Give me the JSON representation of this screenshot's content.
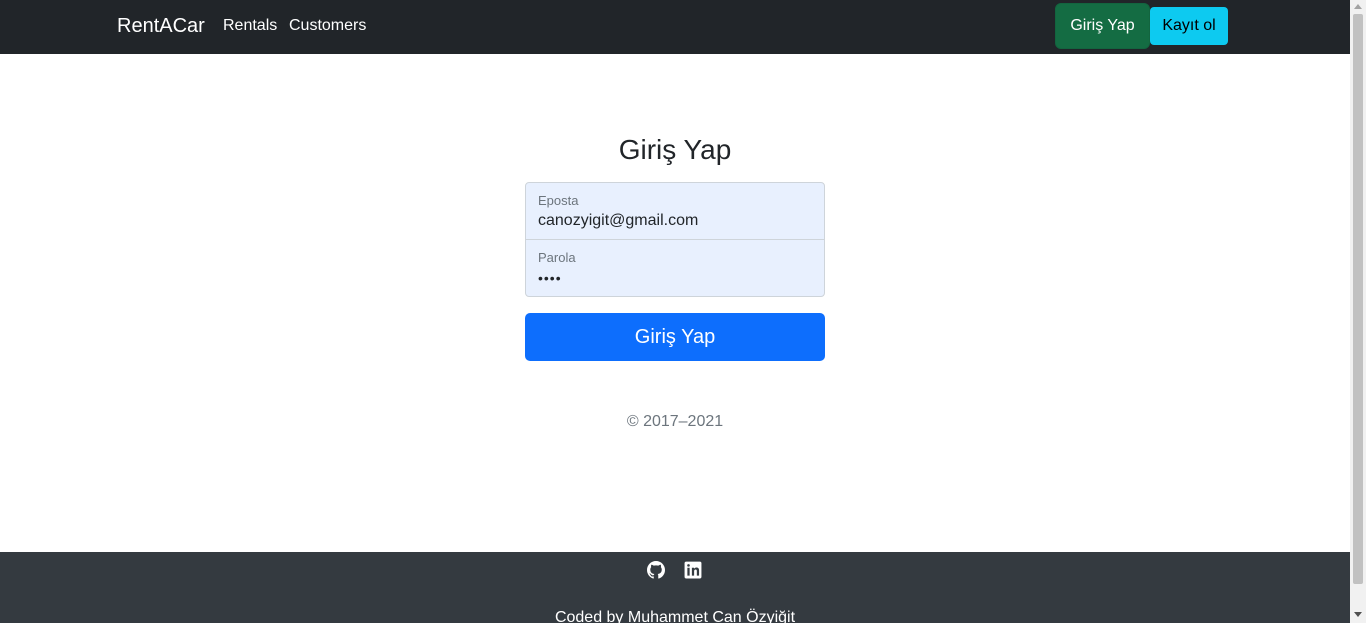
{
  "navbar": {
    "brand": "RentACar",
    "links": [
      "Rentals",
      "Customers"
    ],
    "login_button": "Giriş Yap",
    "register_button": "Kayıt ol"
  },
  "login_form": {
    "title": "Giriş Yap",
    "email": {
      "label": "Eposta",
      "value": "canozyigit@gmail.com"
    },
    "password": {
      "label": "Parola",
      "value": "••••"
    },
    "submit_label": "Giriş Yap",
    "copyright": "© 2017–2021"
  },
  "footer": {
    "icons": [
      "github-icon",
      "linkedin-icon"
    ],
    "credit": "Coded by Muhammet Can Özyiğit"
  },
  "colors": {
    "navbar_bg": "#212529",
    "login_nav_btn": "#146c43",
    "register_nav_btn": "#0dcaf0",
    "submit_btn": "#0d6efd",
    "input_bg": "#e8f0fe",
    "footer_bg": "#343a40"
  }
}
